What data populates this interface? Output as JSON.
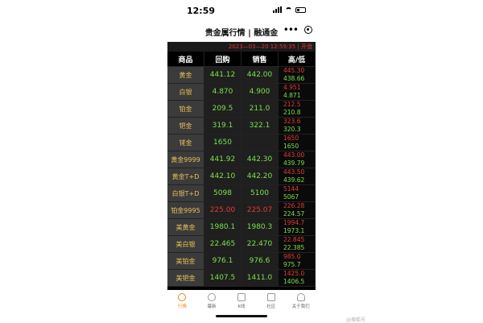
{
  "status_bar": {
    "time": "12:59"
  },
  "nav": {
    "title": "贵金属行情 | 融通金"
  },
  "timestamp": "2023—03—20 12:59:35 | 开盘",
  "columns": [
    "商品",
    "回购",
    "销售",
    "高/低"
  ],
  "rows": [
    {
      "name": "黄金",
      "buy": "441.12",
      "sell": "442.00",
      "high": "445.30",
      "low": "438.66",
      "buy_color": "#7be04a",
      "sell_color": "#7be04a"
    },
    {
      "name": "白银",
      "buy": "4.870",
      "sell": "4.900",
      "high": "4.951",
      "low": "4.871",
      "buy_color": "#7be04a",
      "sell_color": "#7be04a"
    },
    {
      "name": "铂金",
      "buy": "209.5",
      "sell": "211.0",
      "high": "212.5",
      "low": "210.8",
      "buy_color": "#7be04a",
      "sell_color": "#7be04a"
    },
    {
      "name": "钯金",
      "buy": "319.1",
      "sell": "322.1",
      "high": "323.6",
      "low": "320.3",
      "buy_color": "#7be04a",
      "sell_color": "#7be04a"
    },
    {
      "name": "铑金",
      "buy": "1650",
      "sell": "",
      "high": "1650",
      "low": "1650",
      "buy_color": "#7be04a",
      "sell_color": "#7be04a"
    },
    {
      "name": "黄金9999",
      "buy": "441.92",
      "sell": "442.30",
      "high": "443.00",
      "low": "439.79",
      "buy_color": "#7be04a",
      "sell_color": "#7be04a"
    },
    {
      "name": "黄金T+D",
      "buy": "442.10",
      "sell": "442.20",
      "high": "443.50",
      "low": "439.62",
      "buy_color": "#7be04a",
      "sell_color": "#7be04a"
    },
    {
      "name": "白银T+D",
      "buy": "5098",
      "sell": "5100",
      "high": "5144",
      "low": "5067",
      "buy_color": "#7be04a",
      "sell_color": "#7be04a"
    },
    {
      "name": "铂金9995",
      "buy": "225.00",
      "sell": "225.07",
      "high": "226.28",
      "low": "224.57",
      "buy_color": "#e53935",
      "sell_color": "#e53935"
    },
    {
      "name": "美黄金",
      "buy": "1980.1",
      "sell": "1980.3",
      "high": "1994.7",
      "low": "1973.1",
      "buy_color": "#7be04a",
      "sell_color": "#7be04a"
    },
    {
      "name": "美白银",
      "buy": "22.465",
      "sell": "22.470",
      "high": "22.845",
      "low": "22.385",
      "buy_color": "#7be04a",
      "sell_color": "#7be04a"
    },
    {
      "name": "美铂金",
      "buy": "976.1",
      "sell": "976.6",
      "high": "985.0",
      "low": "975.7",
      "buy_color": "#7be04a",
      "sell_color": "#7be04a"
    },
    {
      "name": "美钯金",
      "buy": "1407.5",
      "sell": "1411.0",
      "high": "1425.0",
      "low": "1406.5",
      "buy_color": "#7be04a",
      "sell_color": "#7be04a"
    }
  ],
  "tabs": [
    {
      "label": "行情",
      "icon": "dial-icon",
      "active": true
    },
    {
      "label": "幕新",
      "icon": "gauge-icon",
      "active": false
    },
    {
      "label": "K线",
      "icon": "kline-icon",
      "active": false
    },
    {
      "label": "社区",
      "icon": "home-icon",
      "active": false
    },
    {
      "label": "关于我们",
      "icon": "user-icon",
      "active": false
    }
  ],
  "watermark": "@搜狐号"
}
